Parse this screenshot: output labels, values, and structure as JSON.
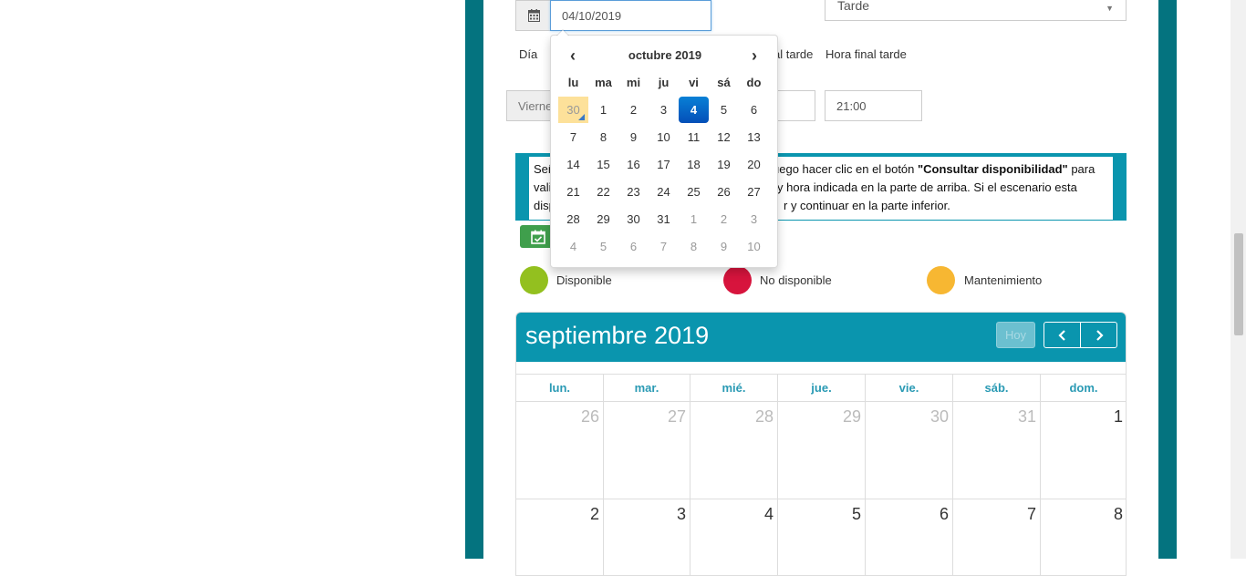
{
  "form": {
    "date_value": "04/10/2019",
    "jornada_select": "Tarde",
    "label_dia": "Día",
    "label_hora_final_tarde_partial": "al tarde",
    "label_hora_final_tarde": "Hora final tarde",
    "dia_value_partial": "Vierne",
    "hora_final_value": "21:00"
  },
  "info": {
    "line1_left": "Señ",
    "line1_right_pre": "uego hacer clic en el botón ",
    "line1_bold": "\"Consultar disponibilidad\"",
    "line1_right_post": " para",
    "line2_left": "vali",
    "line2_right": "y hora indicada en la parte de arriba. Si el escenario esta",
    "line3_left": "disp",
    "line3_right": "r y continuar en la parte inferior."
  },
  "legend": [
    {
      "label": "Disponible",
      "color": "#93c01f"
    },
    {
      "label": "No disponible",
      "color": "#d7143d"
    },
    {
      "label": "Mantenimiento",
      "color": "#f7b732"
    }
  ],
  "calendar": {
    "title": "septiembre 2019",
    "today_button": "Hoy",
    "prev_icon": "chevron-left-icon",
    "next_icon": "chevron-right-icon",
    "days_of_week": [
      "lun.",
      "mar.",
      "mié.",
      "jue.",
      "vie.",
      "sáb.",
      "dom."
    ],
    "week1": [
      "26",
      "27",
      "28",
      "29",
      "30",
      "31",
      "1"
    ],
    "week2": [
      "2",
      "3",
      "4",
      "5",
      "6",
      "7",
      "8"
    ],
    "accent": "#0a95ae"
  },
  "datepicker": {
    "title": "octubre 2019",
    "prev": "‹",
    "next": "›",
    "days_of_week": [
      "lu",
      "ma",
      "mi",
      "ju",
      "vi",
      "sá",
      "do"
    ],
    "weeks": [
      [
        "30",
        "1",
        "2",
        "3",
        "4",
        "5",
        "6"
      ],
      [
        "7",
        "8",
        "9",
        "10",
        "11",
        "12",
        "13"
      ],
      [
        "14",
        "15",
        "16",
        "17",
        "18",
        "19",
        "20"
      ],
      [
        "21",
        "22",
        "23",
        "24",
        "25",
        "26",
        "27"
      ],
      [
        "28",
        "29",
        "30",
        "31",
        "1",
        "2",
        "3"
      ],
      [
        "4",
        "5",
        "6",
        "7",
        "8",
        "9",
        "10"
      ]
    ],
    "today": "30",
    "selected": "4"
  },
  "colors": {
    "frame": "#04737f",
    "selected_day": "#0a62c2",
    "today_highlight": "#fde19a",
    "button_green": "#3f9f4c"
  }
}
